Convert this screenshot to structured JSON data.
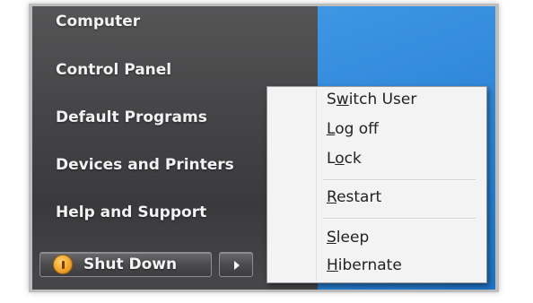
{
  "start_menu": {
    "nav_items": [
      {
        "label": "Computer"
      },
      {
        "label": "Control Panel"
      },
      {
        "label": "Default Programs"
      },
      {
        "label": "Devices and Printers"
      },
      {
        "label": "Help and Support"
      }
    ],
    "shutdown_label": "Shut Down"
  },
  "shutdown_menu": {
    "items": [
      {
        "pre": "S",
        "key": "w",
        "post": "itch User"
      },
      {
        "pre": "",
        "key": "L",
        "post": "og off"
      },
      {
        "pre": "L",
        "key": "o",
        "post": "ck"
      },
      {
        "pre": "",
        "key": "R",
        "post": "estart"
      },
      {
        "pre": "",
        "key": "S",
        "post": "leep"
      },
      {
        "pre": "",
        "key": "H",
        "post": "ibernate"
      }
    ]
  },
  "colors": {
    "panel_dark": "#444446",
    "panel_blue": "#2f86d8",
    "menu_bg": "#f3f3f3",
    "shield_orange": "#f1a52a"
  }
}
